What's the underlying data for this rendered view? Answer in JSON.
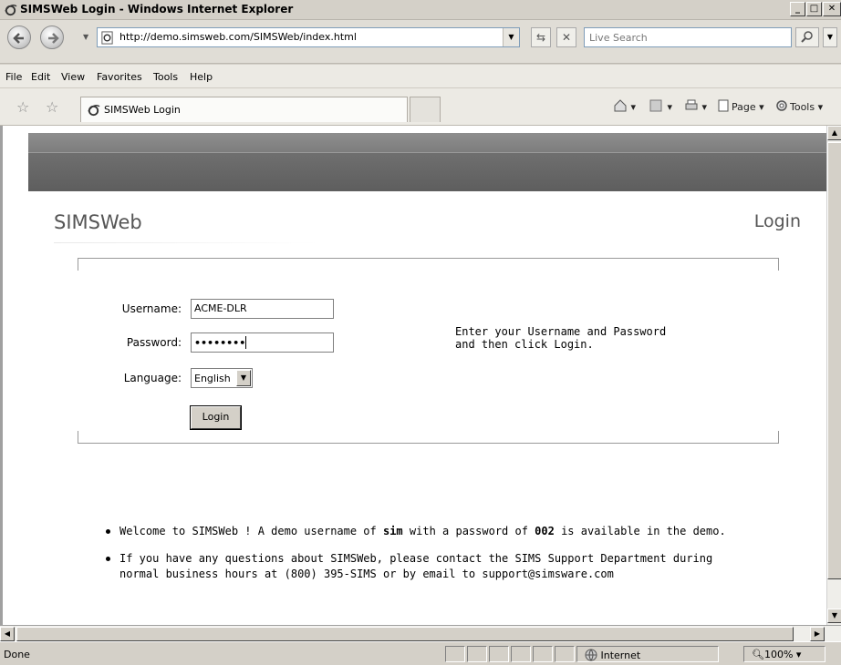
{
  "window": {
    "title": "SIMSWeb Login - Windows Internet Explorer",
    "icon": "ie-icon",
    "controls": [
      "minimize",
      "maximize",
      "close"
    ]
  },
  "address_bar": {
    "url": "http://demo.simsweb.com/SIMSWeb/index.html",
    "search_placeholder": "Live Search"
  },
  "menu": {
    "items": [
      "File",
      "Edit",
      "View",
      "Favorites",
      "Tools",
      "Help"
    ]
  },
  "tabs": {
    "active_label": "SIMSWeb Login"
  },
  "command_bar": {
    "page_label": "Page",
    "tools_label": "Tools"
  },
  "page": {
    "brand": "SIMSWeb",
    "heading": "Login",
    "form": {
      "username_label": "Username:",
      "username_value": "ACME-DLR",
      "password_label": "Password:",
      "password_mask": "••••••••",
      "language_label": "Language:",
      "language_value": "English",
      "login_button": "Login"
    },
    "instructions": [
      "Enter your Username and Password",
      "and then click Login."
    ],
    "bullets": {
      "b1": {
        "pre": "Welcome to SIMSWeb ! A demo username of ",
        "user": "sim",
        "mid": " with a password of ",
        "pass": "002",
        "post": " is available in the demo."
      },
      "b2": {
        "line1": "If you have any questions about SIMSWeb, please contact the SIMS Support Department during",
        "line2": "normal business hours at (800) 395-SIMS or by email to support@simsware.com"
      }
    }
  },
  "status": {
    "text": "Done",
    "zone": "Internet",
    "zoom": "100%"
  },
  "colors": {
    "header_band_light": "#8e8e8e",
    "header_band_dark": "#666666",
    "brand_text": "#555555",
    "url_border": "#7f9db9"
  }
}
